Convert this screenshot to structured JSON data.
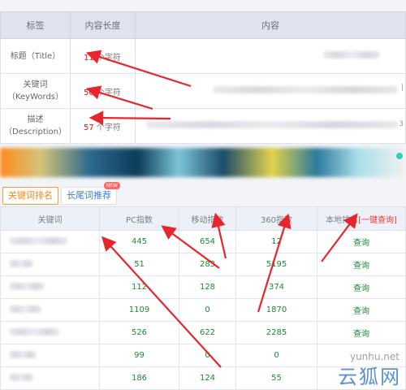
{
  "seo": {
    "headers": {
      "label": "标签",
      "length": "内容长度",
      "content": "内容"
    },
    "rows": [
      {
        "label_lines": [
          "标题（Title）"
        ],
        "length_num": "11",
        "length_unit": "个字符"
      },
      {
        "label_lines": [
          "关键词",
          "（KeyWords）"
        ],
        "length_num": "50",
        "length_unit": "个字符"
      },
      {
        "label_lines": [
          "描述",
          "（Description）"
        ],
        "length_num": "57",
        "length_unit": "个字符"
      }
    ],
    "edge_chars": [
      "|",
      "3"
    ]
  },
  "tabs": {
    "keyword_rank": "关键词排名",
    "long_tail": "长尾词推荐",
    "new_badge": "NEW"
  },
  "keywords": {
    "headers": {
      "keyword": "关键词",
      "pc": "PC指数",
      "mobile": "移动指数",
      "index360": "360指数",
      "local": "本地排名",
      "quick": "[一键查询]"
    },
    "query_label": "查询",
    "rows": [
      {
        "pc": "445",
        "mobile": "654",
        "i360": "12"
      },
      {
        "pc": "51",
        "mobile": "283",
        "i360": "5195"
      },
      {
        "pc": "112",
        "mobile": "128",
        "i360": "374"
      },
      {
        "pc": "1109",
        "mobile": "0",
        "i360": "1870"
      },
      {
        "pc": "526",
        "mobile": "622",
        "i360": "2285"
      },
      {
        "pc": "99",
        "mobile": "0",
        "i360": "0"
      },
      {
        "pc": "186",
        "mobile": "124",
        "i360": "55"
      }
    ]
  },
  "watermark": {
    "site": "yunhu.net",
    "brand": "云狐网"
  },
  "colors": {
    "arrow": "#e8242c",
    "accent_orange": "#f08a1c",
    "link_blue": "#3b7dd8",
    "value_green": "#1c8a34"
  }
}
